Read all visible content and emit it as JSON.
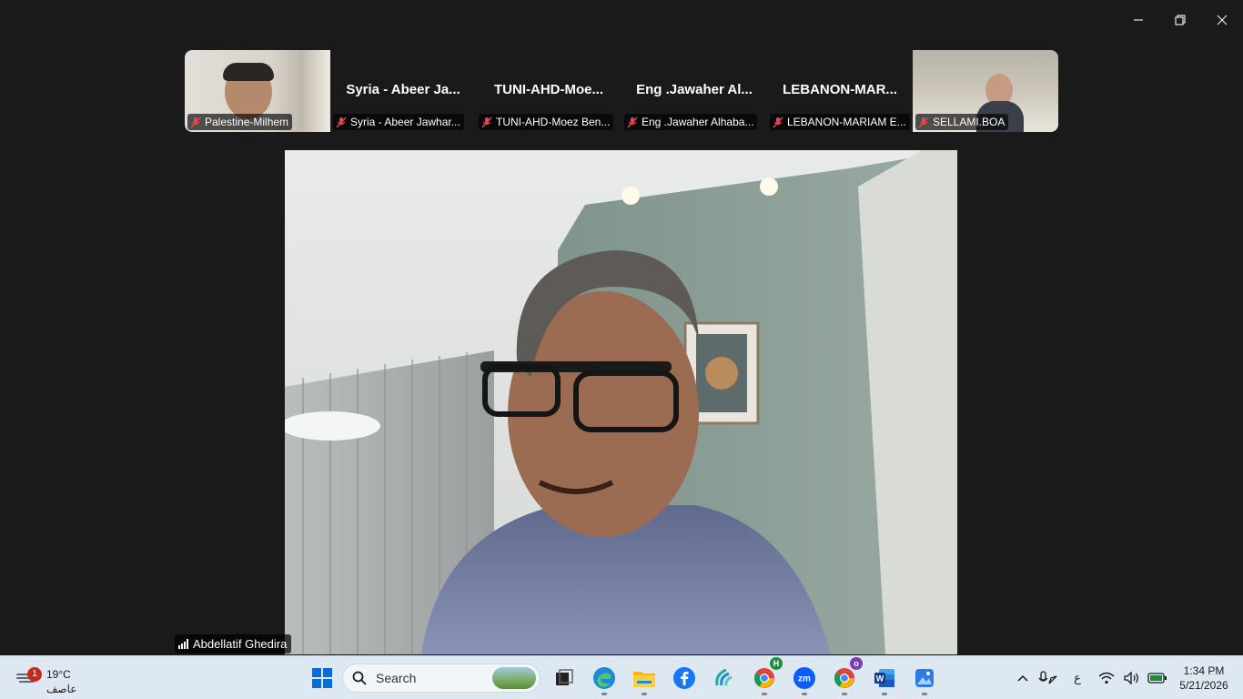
{
  "window": {
    "minimize_icon": "minimize-icon",
    "restore_icon": "restore-icon",
    "close_icon": "close-icon"
  },
  "participants": [
    {
      "display_name": "Palestine-Milhem",
      "label": "Palestine-Milhem",
      "video": true
    },
    {
      "display_name": "Syria - Abeer Ja...",
      "label": "Syria - Abeer Jawhar...",
      "video": false
    },
    {
      "display_name": "TUNI-AHD-Moe...",
      "label": "TUNI-AHD-Moez Ben...",
      "video": false
    },
    {
      "display_name": "Eng .Jawaher Al...",
      "label": "Eng .Jawaher Alhaba...",
      "video": false
    },
    {
      "display_name": "LEBANON-MAR...",
      "label": "LEBANON-MARIAM E...",
      "video": false
    },
    {
      "display_name": "SELLAMI.BOA",
      "label": "SELLAMI.BOA",
      "video": true
    }
  ],
  "speaker": {
    "name": "Abdellatif Ghedira"
  },
  "taskbar": {
    "weather": {
      "badge": "1",
      "temp": "19°C",
      "condition": "عاصف"
    },
    "search_placeholder": "Search",
    "chrome_badge_1": "H",
    "chrome_badge_2": "o",
    "tray_lang": "ع",
    "clock_time": "1:34 PM",
    "clock_date": "5/21/2026"
  },
  "colors": {
    "mic_muted": "#e0484d",
    "taskbar_bg": "#dde8f3",
    "app_bg": "#1a1a1a"
  }
}
